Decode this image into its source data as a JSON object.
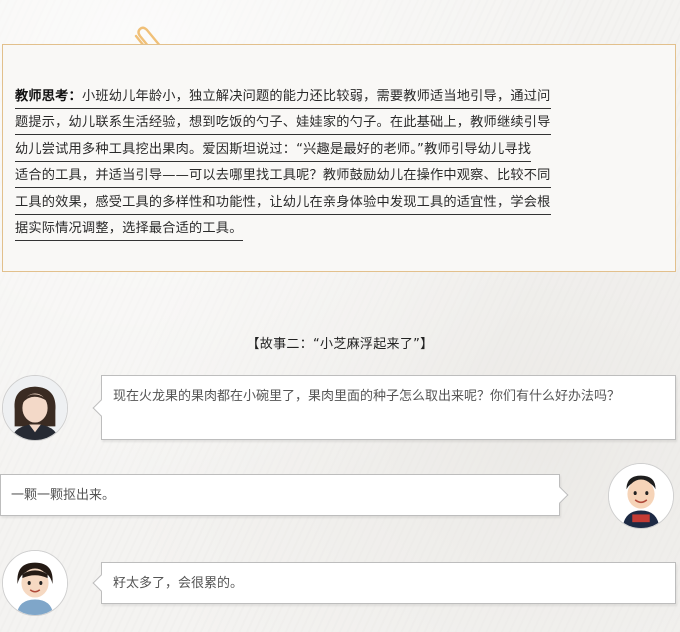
{
  "note": {
    "label": "教师思考：",
    "lines": [
      "小班幼儿年龄小，独立解决问题的能力还比较弱，需要教师适当地引导，通过问",
      "题提示，幼儿联系生活经验，想到吃饭的勺子、娃娃家的勺子。在此基础上，教师继续引导",
      "幼儿尝试用多种工具挖出果肉。爱因斯坦说过：“兴趣是最好的老师。”教师引导幼儿寻找",
      "适合的工具，并适当引导——可以去哪里找工具呢？教师鼓励幼儿在操作中观察、比较不同",
      "工具的效果，感受工具的多样性和功能性，让幼儿在亲身体验中发现工具的适宜性，学会根",
      "据实际情况调整，选择最合适的工具。"
    ]
  },
  "story": {
    "title": "【故事二：“小芝麻浮起来了”】"
  },
  "dialog": [
    {
      "speaker": "teacher",
      "text": "现在火龙果的果肉都在小碗里了，果肉里面的种子怎么取出来呢？你们有什么好办法吗？"
    },
    {
      "speaker": "child-boy",
      "text": "一颗一颗抠出来。"
    },
    {
      "speaker": "child-girl",
      "text": "籽太多了，会很累的。"
    }
  ],
  "colors": {
    "border_accent": "#e2c08c",
    "clip": "#f0c078"
  }
}
